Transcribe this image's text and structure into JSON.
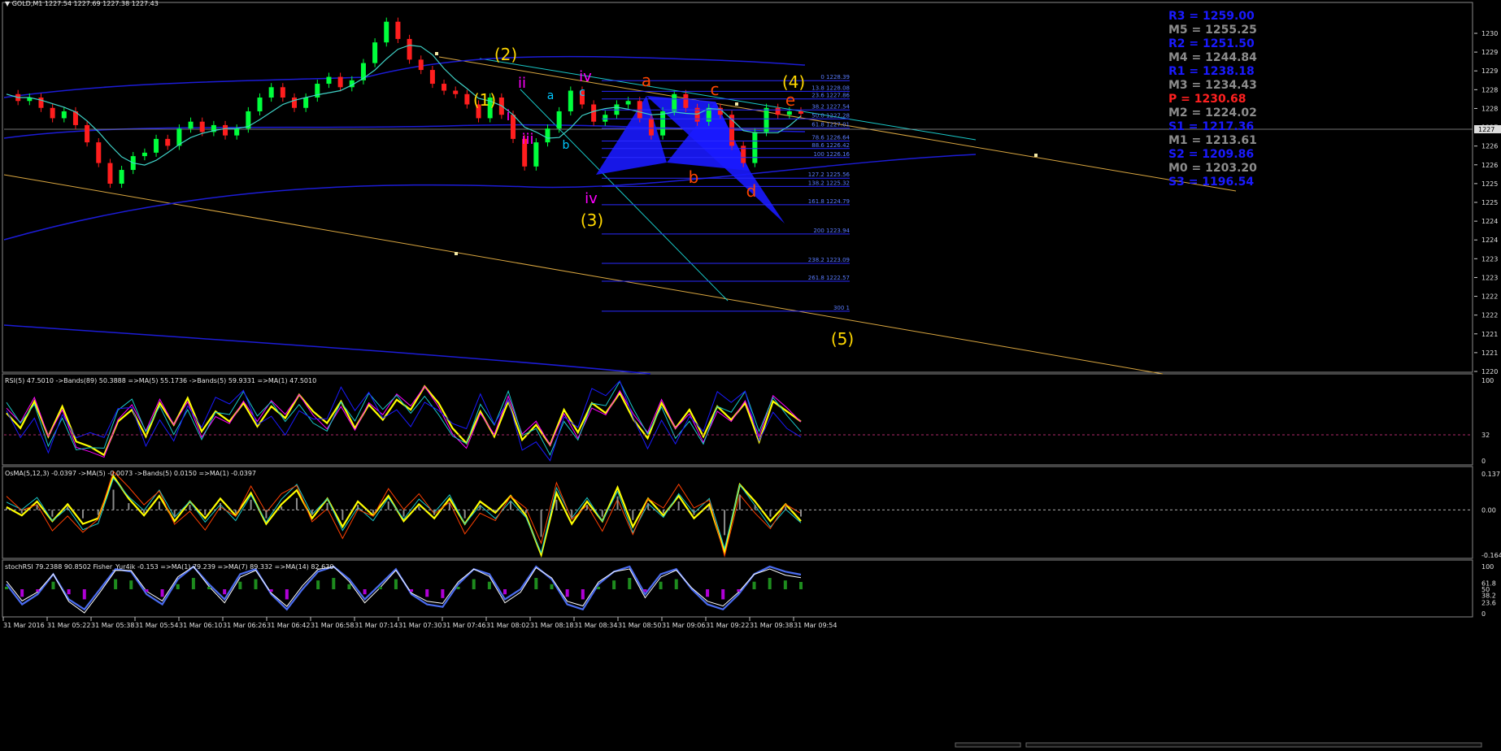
{
  "window": {
    "symbol_label": "GOLD,M1",
    "ohlc": "1227.54 1227.69 1227.38 1227.43"
  },
  "chart_data": [
    {
      "type": "line",
      "name": "price",
      "title": "GOLD,M1  1227.54 1227.69 1227.38 1227.43",
      "y_ticks": [
        "1230",
        "1229",
        "1229",
        "1228",
        "1228",
        "1227",
        "1226",
        "1226",
        "1225",
        "1225",
        "1224",
        "1224",
        "1223",
        "1223",
        "1222",
        "1222",
        "1221",
        "1221",
        "1220"
      ],
      "current_price_label": "1227",
      "ylim": [
        1220,
        1230.4
      ],
      "x_time_labels": [
        "31 Mar 2016",
        "31 Mar 05:22",
        "31 Mar 05:38",
        "31 Mar 05:54",
        "31 Mar 06:10",
        "31 Mar 06:26",
        "31 Mar 06:42",
        "31 Mar 06:58",
        "31 Mar 07:14",
        "31 Mar 07:30",
        "31 Mar 07:46",
        "31 Mar 08:02",
        "31 Mar 08:18",
        "31 Mar 08:34",
        "31 Mar 08:50",
        "31 Mar 09:06",
        "31 Mar 09:22",
        "31 Mar 09:38",
        "31 Mar 09:54"
      ],
      "close_series": [
        1228.0,
        1227.8,
        1227.9,
        1227.6,
        1227.3,
        1227.5,
        1227.1,
        1226.6,
        1226.0,
        1225.4,
        1225.8,
        1226.2,
        1226.3,
        1226.7,
        1226.5,
        1227.0,
        1227.2,
        1226.9,
        1227.1,
        1226.8,
        1227.0,
        1227.5,
        1227.9,
        1228.2,
        1227.9,
        1227.6,
        1227.9,
        1228.3,
        1228.5,
        1228.2,
        1228.4,
        1228.9,
        1229.5,
        1230.1,
        1229.6,
        1229.0,
        1228.7,
        1228.3,
        1228.1,
        1228.0,
        1227.7,
        1227.3,
        1227.9,
        1227.4,
        1226.7,
        1225.9,
        1226.6,
        1227.0,
        1227.5,
        1228.1,
        1227.7,
        1227.2,
        1227.4,
        1227.7,
        1227.8,
        1227.3,
        1226.8,
        1227.5,
        1228.0,
        1227.6,
        1227.2,
        1227.6,
        1227.4,
        1226.5,
        1226.0,
        1226.9,
        1227.6,
        1227.4,
        1227.5,
        1227.43
      ],
      "fibonacci_levels": [
        {
          "label": "0 1228.39",
          "value": 1228.39
        },
        {
          "label": "13.8 1228.08",
          "value": 1228.08
        },
        {
          "label": "23.6 1227.86",
          "value": 1227.86
        },
        {
          "label": "38.2 1227.54",
          "value": 1227.54
        },
        {
          "label": "50.0 1227.28",
          "value": 1227.28
        },
        {
          "label": "61.8 1227.01",
          "value": 1227.01
        },
        {
          "label": "78.6 1226.64",
          "value": 1226.64
        },
        {
          "label": "88.6 1226.42",
          "value": 1226.42
        },
        {
          "label": "100 1226.16",
          "value": 1226.16
        },
        {
          "label": "127.2 1225.56",
          "value": 1225.56
        },
        {
          "label": "138.2 1225.32",
          "value": 1225.32
        },
        {
          "label": "161.8 1224.79",
          "value": 1224.79
        },
        {
          "label": "200 1223.94",
          "value": 1223.94
        },
        {
          "label": "238.2 1223.09",
          "value": 1223.09
        },
        {
          "label": "261.8 1222.57",
          "value": 1222.57
        },
        {
          "label": "300 1",
          "value": 1221.7
        }
      ],
      "pivot_levels": [
        {
          "label": "R3 = 1259.00",
          "color": "#1a1aff"
        },
        {
          "label": "M5 = 1255.25",
          "color": "#8c8c8c"
        },
        {
          "label": "R2 = 1251.50",
          "color": "#1a1aff"
        },
        {
          "label": "M4 = 1244.84",
          "color": "#8c8c8c"
        },
        {
          "label": "R1 = 1238.18",
          "color": "#1a1aff"
        },
        {
          "label": "M3 = 1234.43",
          "color": "#8c8c8c"
        },
        {
          "label": "P = 1230.68",
          "color": "#ff2020"
        },
        {
          "label": "M2 = 1224.02",
          "color": "#8c8c8c"
        },
        {
          "label": "S1 = 1217.36",
          "color": "#1a1aff"
        },
        {
          "label": "M1 = 1213.61",
          "color": "#8c8c8c"
        },
        {
          "label": "S2 = 1209.86",
          "color": "#1a1aff"
        },
        {
          "label": "M0 = 1203.20",
          "color": "#8c8c8c"
        },
        {
          "label": "S3 = 1196.54",
          "color": "#1a1aff"
        }
      ],
      "wave_labels": [
        {
          "text": "(1)",
          "color": "#ffd700"
        },
        {
          "text": "(2)",
          "color": "#ffd700"
        },
        {
          "text": "(3)",
          "color": "#ffd700"
        },
        {
          "text": "(4)",
          "color": "#ffd700"
        },
        {
          "text": "(5)",
          "color": "#ffd700"
        },
        {
          "text": "i",
          "color": "#ff00ff"
        },
        {
          "text": "ii",
          "color": "#ff00ff"
        },
        {
          "text": "iii",
          "color": "#ff00ff"
        },
        {
          "text": "iv",
          "color": "#ff00ff"
        },
        {
          "text": "iv",
          "color": "#ff00ff"
        },
        {
          "text": "a",
          "color": "#00c8ff"
        },
        {
          "text": "b",
          "color": "#00c8ff"
        },
        {
          "text": "c",
          "color": "#00c8ff"
        },
        {
          "text": "a",
          "color": "#ff4500"
        },
        {
          "text": "b",
          "color": "#ff4500"
        },
        {
          "text": "c",
          "color": "#ff4500"
        },
        {
          "text": "d",
          "color": "#ff4500"
        },
        {
          "text": "e",
          "color": "#ff4500"
        }
      ]
    },
    {
      "type": "line",
      "name": "rsi",
      "title": "RSI(5) 47.5010  ->Bands(89) 50.3888  =>MA(5) 55.1736  ->Bands(5) 59.9331  =>MA(1) 47.5010",
      "y_ticks": [
        "100",
        "32",
        "0"
      ],
      "ylim": [
        0,
        100
      ],
      "series": [
        {
          "values": [
            58,
            40,
            72,
            30,
            66,
            24,
            18,
            8,
            48,
            62,
            30,
            70,
            44,
            76,
            36,
            60,
            48,
            70,
            42,
            66,
            52,
            80,
            60,
            46,
            72,
            40,
            68,
            50,
            74,
            62,
            90,
            70,
            40,
            22,
            60,
            30,
            72,
            26,
            44,
            20,
            62,
            35,
            70,
            58,
            82,
            50,
            28,
            70,
            40,
            62,
            30,
            66,
            50,
            70,
            24,
            72,
            60,
            48
          ]
        }
      ]
    },
    {
      "type": "line",
      "name": "osma",
      "title": "OsMA(5,12,3) -0.0397  ->MA(5) -0.0073  ->Bands(5) 0.0150  =>MA(1) -0.0397",
      "y_ticks": [
        "0.137",
        "0.00",
        "-0.164"
      ],
      "ylim": [
        -0.164,
        0.137
      ],
      "series": [
        {
          "values": [
            0.01,
            -0.02,
            0.03,
            -0.04,
            0.02,
            -0.05,
            -0.03,
            0.12,
            0.04,
            -0.02,
            0.05,
            -0.04,
            0.03,
            -0.03,
            0.04,
            -0.02,
            0.06,
            -0.05,
            0.02,
            0.07,
            -0.03,
            0.04,
            -0.06,
            0.03,
            -0.02,
            0.05,
            -0.04,
            0.02,
            -0.03,
            0.04,
            -0.05,
            0.03,
            -0.01,
            0.05,
            -0.02,
            -0.16,
            0.06,
            -0.05,
            0.03,
            -0.04,
            0.08,
            -0.06,
            0.04,
            -0.02,
            0.05,
            -0.03,
            0.02,
            -0.15,
            0.09,
            0.03,
            -0.04,
            0.02,
            -0.0397
          ]
        }
      ]
    },
    {
      "type": "line",
      "name": "stoch",
      "title": "stochRSI 79.2388 90.8502  Fisher_Yur4ik -0.153  =>MA(1) 79.239  =>MA(7) 89.332  =>MA(14) 82.630",
      "y_ticks": [
        "100",
        "61.8",
        "50",
        "38.2",
        "23.6",
        "0"
      ],
      "ylim": [
        0,
        100
      ],
      "series": [
        {
          "values": [
            60,
            20,
            40,
            80,
            30,
            10,
            50,
            90,
            85,
            40,
            20,
            70,
            95,
            60,
            30,
            80,
            90,
            40,
            10,
            50,
            85,
            95,
            70,
            30,
            60,
            90,
            40,
            20,
            15,
            60,
            90,
            80,
            30,
            50,
            95,
            70,
            20,
            10,
            60,
            85,
            95,
            40,
            80,
            90,
            50,
            20,
            10,
            40,
            80,
            95,
            85,
            79
          ]
        }
      ]
    }
  ]
}
